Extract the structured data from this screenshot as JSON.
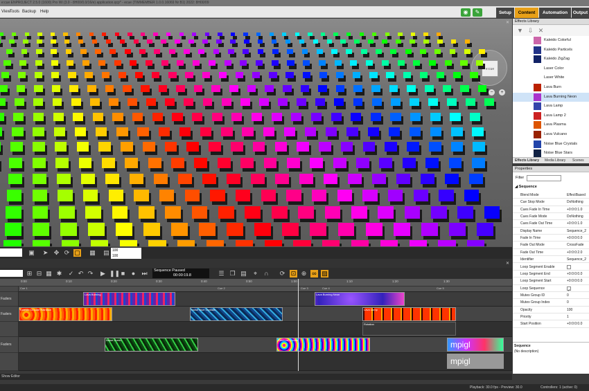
{
  "window": {
    "title": "e:cue ENPROJECT 2.5.0 (1600) Pro Wi (3.0 - 8H00/0.0/16/e) application.qcp* - ecue (TIMMEMBER 1.0.0.16069 Nr B1) 2022: 8H00/09"
  },
  "menu": {
    "view": "View",
    "tools": "Tools",
    "backup": "Backup",
    "help": "Help"
  },
  "main_tabs": [
    {
      "label": "Setup"
    },
    {
      "label": "Content"
    },
    {
      "label": "Automation"
    },
    {
      "label": "Output"
    }
  ],
  "effects_library": {
    "title": "Effects Library",
    "items": [
      {
        "label": "Kaleido Colorful",
        "color": "#cc66aa"
      },
      {
        "label": "Kaleido Particels",
        "color": "#223388"
      },
      {
        "label": "Kaleido ZigZag",
        "color": "#112266"
      },
      {
        "label": "Laser Color",
        "color": "#ffffff"
      },
      {
        "label": "Laser White",
        "color": "#ffffff"
      },
      {
        "label": "Lava Burn",
        "color": "#bb2200"
      },
      {
        "label": "Lava Burning Neon",
        "color": "#aa33cc"
      },
      {
        "label": "Lava Lamp",
        "color": "#3344aa"
      },
      {
        "label": "Lava Lamp 2",
        "color": "#cc2222"
      },
      {
        "label": "Lava Plasma",
        "color": "#dd5500"
      },
      {
        "label": "Lava Vulcano",
        "color": "#992200"
      },
      {
        "label": "Noise Blue Crystals",
        "color": "#2244aa"
      },
      {
        "label": "Noise Blue Stars",
        "color": "#112244"
      }
    ],
    "tabs": [
      "Effects Library",
      "Media Library",
      "Scenes"
    ]
  },
  "properties": {
    "title": "Properties",
    "filter_label": "Filter",
    "filter_value": "",
    "section": "Sequence",
    "rows": [
      {
        "key": "Blend Mode",
        "value": "EffectBased"
      },
      {
        "key": "Cue Stop Mode",
        "value": "DoNothing"
      },
      {
        "key": "Cues Fade In Time",
        "value": "+0:0:0:1.0"
      },
      {
        "key": "Cues Fade Mode",
        "value": "DoNothing"
      },
      {
        "key": "Cues Fade Out Time",
        "value": "+0:0:0:1.0"
      },
      {
        "key": "Display Name",
        "value": "Sequence_2"
      },
      {
        "key": "Fade In Time",
        "value": "+0:0:0:0.0"
      },
      {
        "key": "Fade Out Mode",
        "value": "CrossFade"
      },
      {
        "key": "Fade Out Time",
        "value": "+0:0:0:2.0"
      },
      {
        "key": "Identifier",
        "value": "Sequence_2"
      },
      {
        "key": "Loop Segment Enable",
        "value": ""
      },
      {
        "key": "Loop Segment End",
        "value": "+0:0:0:0.0"
      },
      {
        "key": "Loop Segment Start",
        "value": "+0:0:0:0.0"
      },
      {
        "key": "Loop Sequence",
        "value": ""
      },
      {
        "key": "Mutex Group ID",
        "value": "0"
      },
      {
        "key": "Mutex Group Index",
        "value": "0"
      },
      {
        "key": "Opacity",
        "value": "100"
      },
      {
        "key": "Priority",
        "value": "1"
      },
      {
        "key": "Start Position",
        "value": "+0:0:0:0.0"
      }
    ],
    "description_title": "Sequence",
    "description": "(No description)"
  },
  "viewport": {
    "input1": "100",
    "input2": "100",
    "navcube_label": "e:cue"
  },
  "sequence": {
    "status_line1": "Sequence Paused",
    "status_line2": "00:00:19.8",
    "ruler": [
      "0:00",
      "0:10",
      "0:20",
      "0:30",
      "0:40",
      "0:50",
      "1:00",
      "1:10",
      "1:20",
      "1:30"
    ],
    "tracks": [
      {
        "label": "Faders"
      },
      {
        "label": "Faders"
      },
      {
        "label": ""
      },
      {
        "label": "Faders"
      },
      {
        "label": ""
      }
    ],
    "clips": [
      {
        "name": "Lava Burning",
        "color": "#5522aa"
      },
      {
        "name": "Lava Burning Neon",
        "color": "#4433cc"
      },
      {
        "name": "Kaleido Circular Rainbow",
        "color": "#ff8800"
      },
      {
        "name": "Noise Blue Crystals",
        "color": "#1166aa"
      },
      {
        "name": "Lava Lamp",
        "color": "#aa1100"
      },
      {
        "name": "Rotation",
        "color": "#444444"
      },
      {
        "name": "Noise Green",
        "color": "#118822"
      },
      {
        "name": "Rainbow Circles",
        "color": "#ffee00"
      },
      {
        "name": "mpigl",
        "color": "#7733ff"
      },
      {
        "name": "mpigl",
        "color": "#888888"
      }
    ],
    "cues": [
      "Cue 1",
      "Cue 2",
      "Cue 3",
      "Cue 4",
      "Cue 5"
    ]
  },
  "status": {
    "left": "Show Editor",
    "playback": "Playback: 30.0 fps - Preview: 30.0",
    "controllers": "Controllers: 1 (active: 0)"
  },
  "colors": {
    "accent": "#e8a018",
    "green": "#3aa33a"
  }
}
